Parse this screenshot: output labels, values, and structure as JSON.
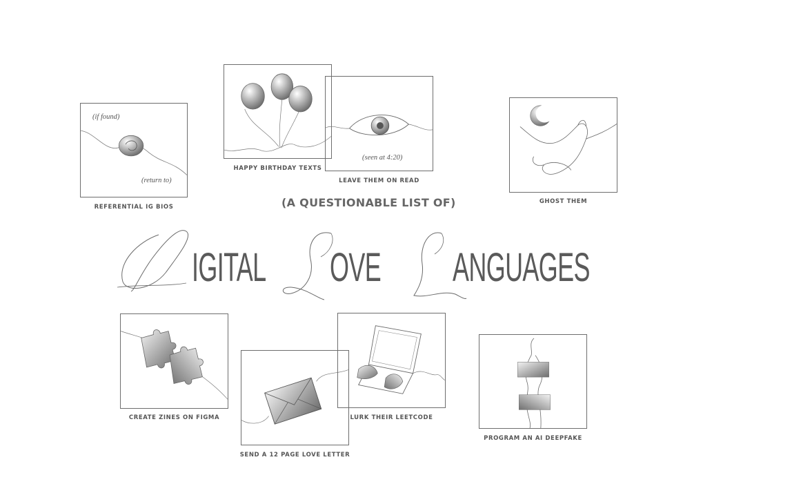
{
  "subtitle": "(A QUESTIONABLE LIST OF)",
  "title": {
    "initials": [
      "D",
      "L",
      "L"
    ],
    "words": [
      "IGITAL",
      "OVE",
      "ANGUAGES"
    ]
  },
  "cards": {
    "bios": {
      "caption": "REFERENTIAL IG BIOS",
      "note_top": "(if found)",
      "note_bottom": "(return to)"
    },
    "birthday": {
      "caption": "HAPPY BIRTHDAY TEXTS"
    },
    "read": {
      "caption": "LEAVE THEM ON READ",
      "note": "(seen at 4:20)"
    },
    "ghost": {
      "caption": "GHOST THEM"
    },
    "zines": {
      "caption": "CREATE ZINES ON FIGMA"
    },
    "letter": {
      "caption": "SEND A 12 PAGE LOVE LETTER"
    },
    "leetcode": {
      "caption": "LURK THEIR LEETCODE"
    },
    "deepfake": {
      "caption": "PROGRAM AN AI DEEPFAKE"
    }
  },
  "colors": {
    "line": "#6d6d6d",
    "text": "#555555",
    "fill_light": "#eeeeee",
    "fill_dark": "#7a7a7a"
  }
}
